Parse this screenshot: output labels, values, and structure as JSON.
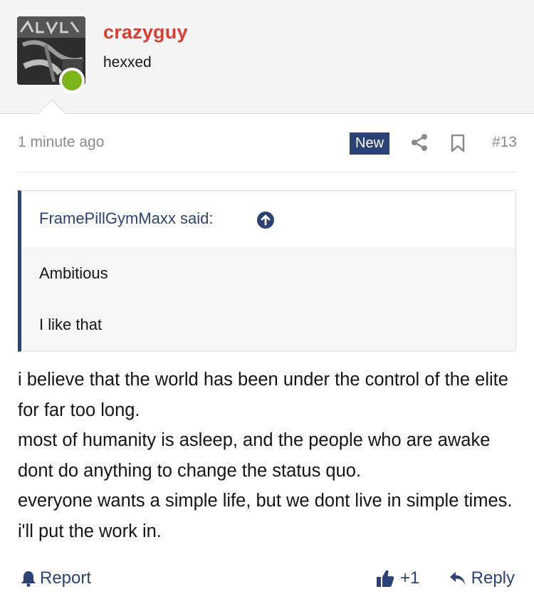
{
  "user": {
    "name": "crazyguy",
    "title": "hexxed",
    "avatar_icon": "user-avatar-image",
    "status": "online"
  },
  "post": {
    "time": "1 minute ago",
    "badge": "New",
    "number": "#13"
  },
  "quote": {
    "author": "FramePillGymMaxx said:",
    "lines": [
      "Ambitious",
      "I like that"
    ]
  },
  "body": {
    "paragraphs": [
      "i believe that the world has been under the control of the elite for far too long.",
      "most of humanity is asleep, and the people who are awake dont do anything to change the status quo.",
      "everyone wants a simple life, but we dont live in simple times. i'll put the work in."
    ]
  },
  "actions": {
    "report": "Report",
    "likes": "+1",
    "reply": "Reply"
  },
  "colors": {
    "username": "#e03a2f",
    "accent": "#2b4276",
    "online": "#7cb518",
    "muted": "#8a8a8a"
  }
}
